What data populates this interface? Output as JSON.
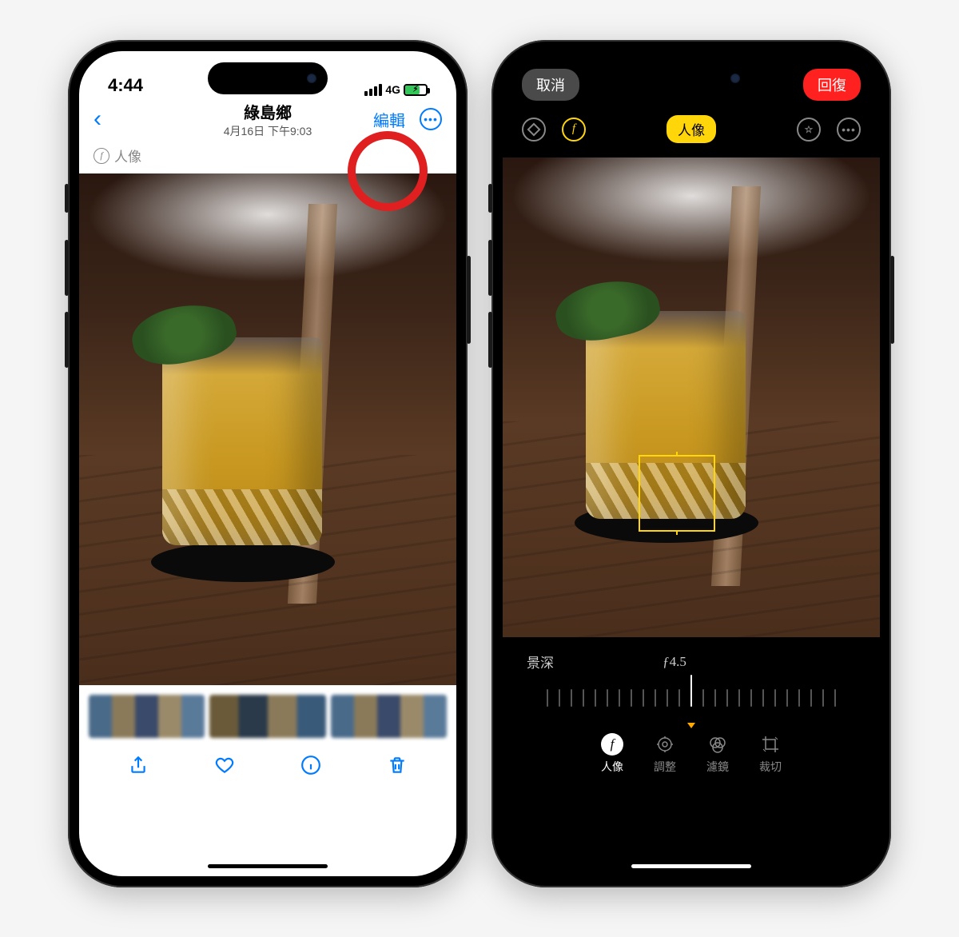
{
  "left": {
    "statusbar": {
      "time": "4:44",
      "carrier": "4G"
    },
    "nav": {
      "title": "綠島鄉",
      "subtitle": "4月16日 下午9:03",
      "edit_label": "編輯"
    },
    "mode_label": "人像",
    "toolbar": {
      "share": "share-icon",
      "favorite": "heart-icon",
      "info": "info-icon",
      "delete": "trash-icon"
    }
  },
  "right": {
    "top": {
      "cancel": "取消",
      "restore": "回復"
    },
    "mode_pill": "人像",
    "depth": {
      "label": "景深",
      "value": "ƒ4.5"
    },
    "tabs": [
      {
        "id": "portrait",
        "label": "人像",
        "selected": true
      },
      {
        "id": "adjust",
        "label": "調整",
        "selected": false
      },
      {
        "id": "filter",
        "label": "濾鏡",
        "selected": false
      },
      {
        "id": "crop",
        "label": "裁切",
        "selected": false
      }
    ]
  }
}
